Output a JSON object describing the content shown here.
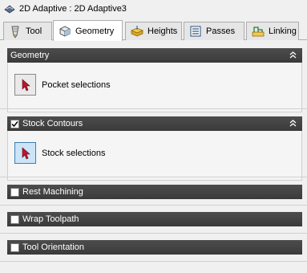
{
  "window": {
    "title": "2D Adaptive : 2D Adaptive3",
    "icon": "adaptive-app-icon"
  },
  "tabs": [
    {
      "label": "Tool",
      "icon": "tool-icon",
      "active": false
    },
    {
      "label": "Geometry",
      "icon": "geometry-icon",
      "active": true
    },
    {
      "label": "Heights",
      "icon": "heights-icon",
      "active": false
    },
    {
      "label": "Passes",
      "icon": "passes-icon",
      "active": false
    },
    {
      "label": "Linking",
      "icon": "linking-icon",
      "active": false
    }
  ],
  "sections": {
    "geometry": {
      "title": "Geometry",
      "selection_label": "Pocket selections",
      "expanded": true
    },
    "stock_contours": {
      "title": "Stock Contours",
      "checked": true,
      "selection_label": "Stock selections",
      "expanded": true
    },
    "rest_machining": {
      "title": "Rest Machining",
      "checked": false
    },
    "wrap_toolpath": {
      "title": "Wrap Toolpath",
      "checked": false
    },
    "tool_orientation": {
      "title": "Tool Orientation",
      "checked": false
    }
  },
  "colors": {
    "header_bg": "#3f3f3f",
    "selection_active": "#cce4f7",
    "cursor_arrow": "#c0142c"
  }
}
